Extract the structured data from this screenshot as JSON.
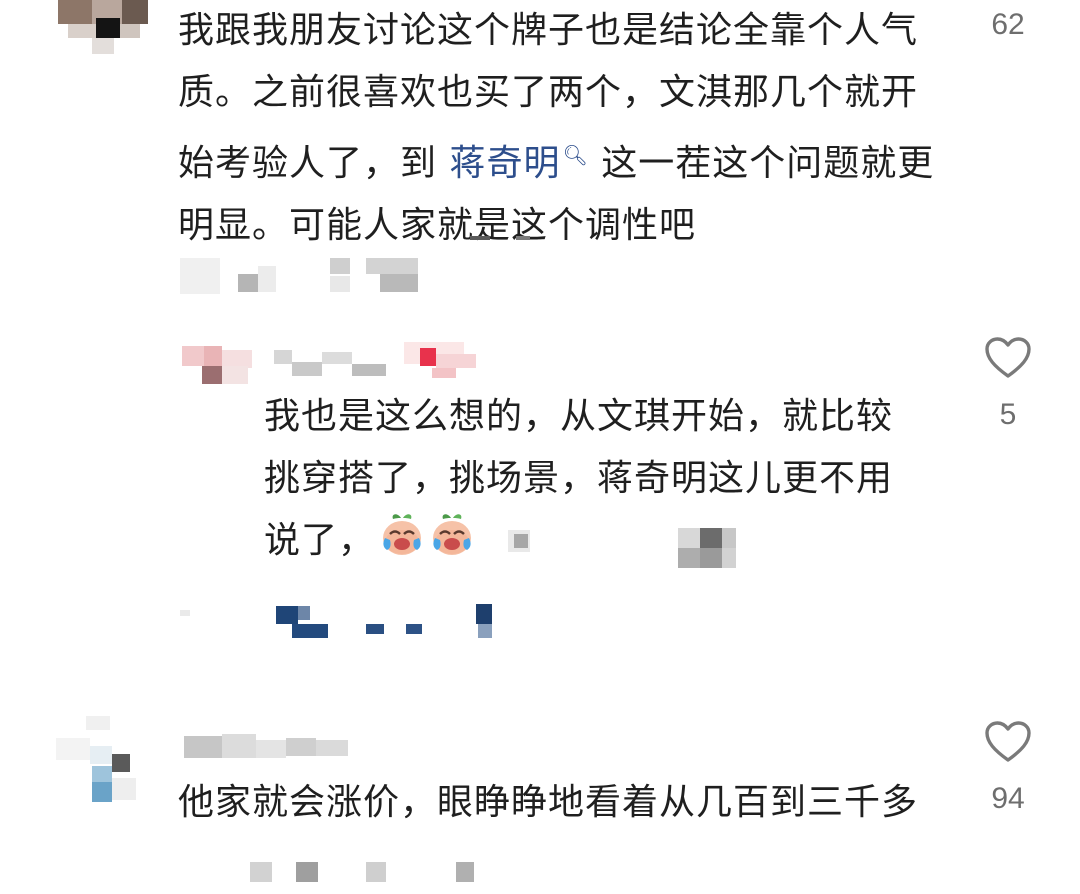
{
  "comments": [
    {
      "text_before_link": "我跟我朋友讨论这个牌子也是结论全靠个人气质。之前很喜欢也买了两个，文淇那几个就开始考验人了，到 ",
      "link_text": "蒋奇明",
      "text_after_link": " 这一茬这个问题就更明显。可能人家就是这个调性吧",
      "like_count": "62"
    },
    {
      "text": "他家就会涨价，眼睁睁地看着从几百到三千多",
      "like_count": "94"
    }
  ],
  "reply": {
    "text": "我也是这么想的，从文琪开始，就比较挑穿搭了，挑场景，蒋奇明这儿更不用说了，",
    "emojis": [
      "crying-laughing-peach-emoji",
      "crying-laughing-peach-emoji"
    ],
    "like_count": "5"
  },
  "icons": {
    "like": "heart-outline-icon",
    "search_link": "search-icon"
  },
  "colors": {
    "text": "#1f1f1f",
    "link": "#2d4e8c",
    "count": "#6e6e6e"
  }
}
